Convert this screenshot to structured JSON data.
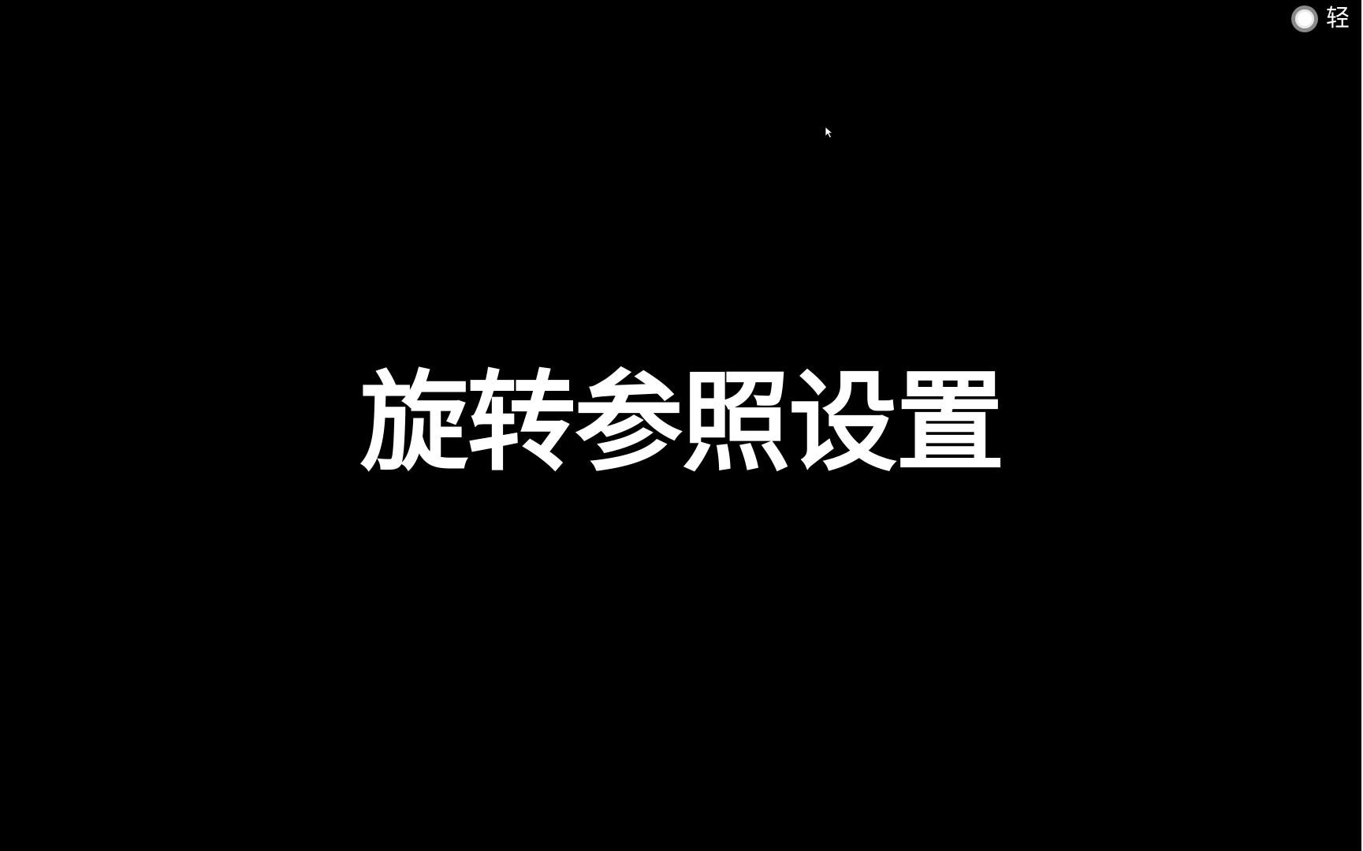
{
  "slide": {
    "title": "旋转参照设置"
  },
  "recorder": {
    "label": "轻​",
    "icon": "record-icon"
  },
  "colors": {
    "background": "#000000",
    "text": "#ffffff"
  }
}
